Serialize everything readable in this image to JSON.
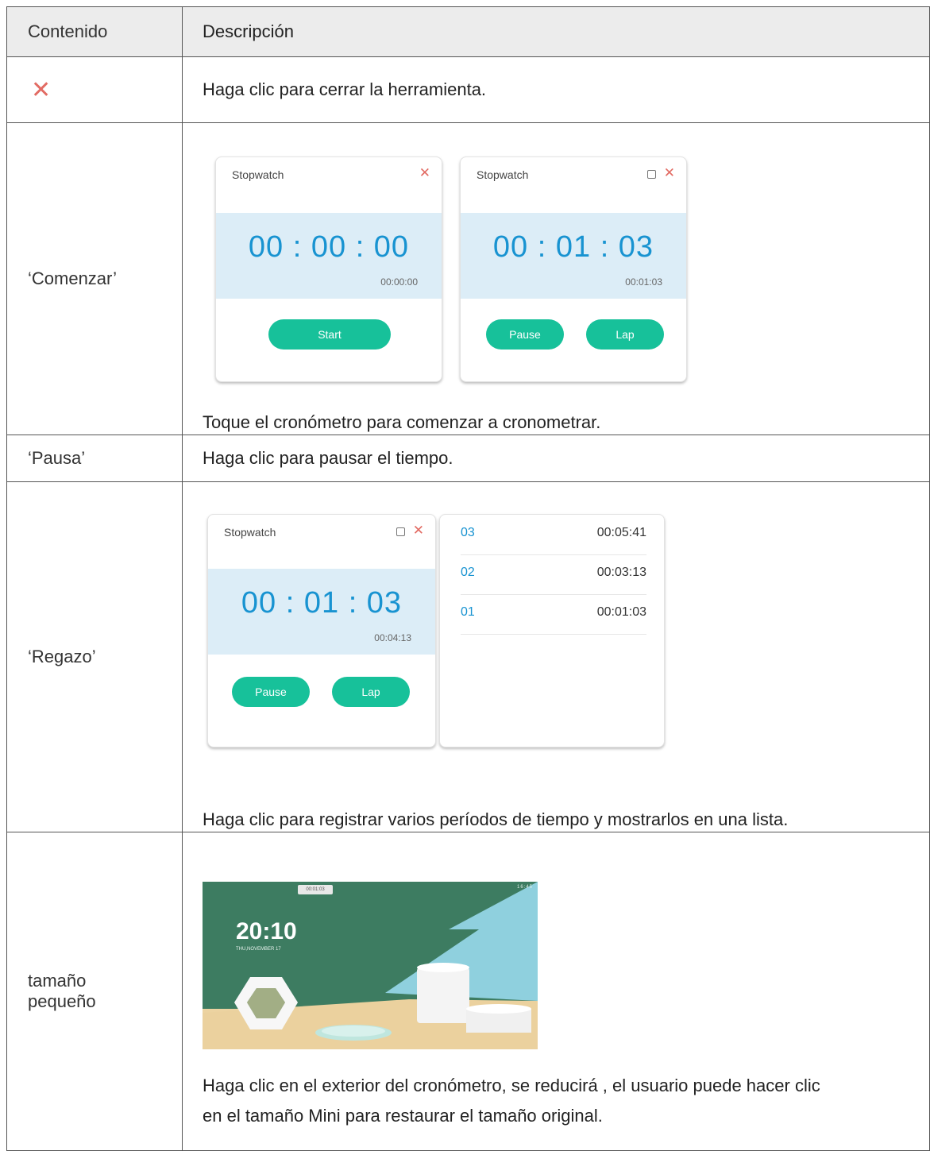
{
  "header": {
    "col1": "Contenido",
    "col2": "Descripción"
  },
  "rows": {
    "close": {
      "icon": "close-icon",
      "description": "Haga clic para cerrar la herramienta."
    },
    "start": {
      "label": "‘Comenzar’",
      "caption": "Toque el cronómetro para comenzar a cronometrar.",
      "widget_a": {
        "title": "Stopwatch",
        "big": "00 : 00 : 00",
        "small": "00:00:00",
        "button": "Start"
      },
      "widget_b": {
        "title": "Stopwatch",
        "big": "00 : 01 : 03",
        "small": "00:01:03",
        "button1": "Pause",
        "button2": "Lap"
      }
    },
    "pause": {
      "label": "‘Pausa’",
      "description": "Haga clic para pausar el tiempo."
    },
    "lap": {
      "label": "‘Regazo’",
      "caption": "Haga clic para registrar varios períodos de tiempo y mostrarlos en una lista.",
      "widget": {
        "title": "Stopwatch",
        "big": "00 : 01 : 03",
        "small": "00:04:13",
        "button1": "Pause",
        "button2": "Lap"
      },
      "laps": [
        {
          "n": "03",
          "t": "00:05:41"
        },
        {
          "n": "02",
          "t": "00:03:13"
        },
        {
          "n": "01",
          "t": "00:01:03"
        }
      ]
    },
    "mini": {
      "label_line1": "tamaño",
      "label_line2": "pequeño",
      "caption_line1": "Haga clic en el exterior del cronómetro, se reducirá , el usuario puede hacer clic",
      "caption_line2": "en el tamaño Mini para restaurar el tamaño original.",
      "screen": {
        "badge": "00:01:03",
        "status": "16:45",
        "clock": "20:10",
        "date": "THU,NOVEMBER 17"
      }
    }
  },
  "colors": {
    "accent_green": "#17c19a",
    "time_blue": "#1893d1",
    "close_red": "#e26b63",
    "band": "#dcedf7"
  }
}
